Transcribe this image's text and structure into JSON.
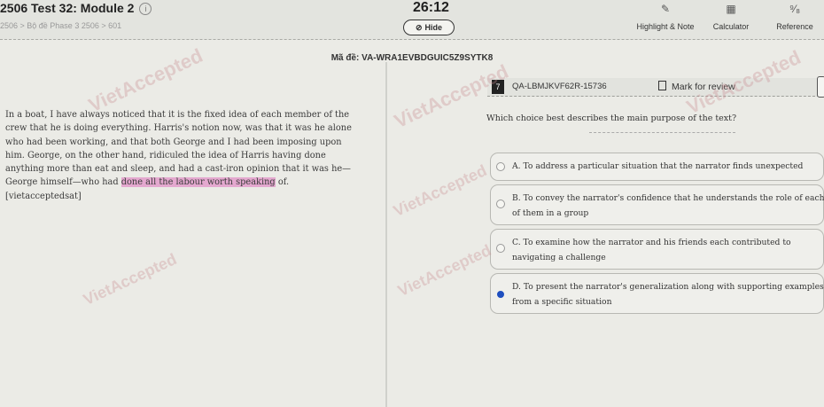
{
  "header": {
    "title": "2506 Test 32: Module 2",
    "breadcrumb": "2506 > Bộ đề Phase 3 2506 > 601",
    "timer": "26:12",
    "hide_label": "Hide",
    "tools": [
      {
        "label": "Highlight & Note",
        "icon": "pencil-icon"
      },
      {
        "label": "Calculator",
        "icon": "calculator-icon"
      },
      {
        "label": "Reference",
        "icon": "reference-icon"
      }
    ]
  },
  "exam_code": "Mã đề: VA-WRA1EVBDGUIC5Z9SYTK8",
  "passage": {
    "before_highlight": "In a boat, I have always noticed that it is the fixed idea of each member of the crew that he is doing everything. Harris's notion now, was that it was he alone who had been working, and that both George and I had been imposing upon him. George, on the other hand, ridiculed the idea of Harris having done anything more than eat and sleep, and had a cast-iron opinion that it was he—George himself—who had ",
    "highlight": "done all the labour worth speaking",
    "after_highlight": " of.",
    "source_tag": "[vietacceptedsat]"
  },
  "question": {
    "number": "7",
    "id": "QA-LBMJKVF62R-15736",
    "mark_label": "Mark for review",
    "text": "Which choice best describes the main purpose of the text?",
    "options": [
      {
        "text": "A. To address a particular situation that the narrator finds unexpected",
        "selected": false
      },
      {
        "text": "B. To convey the narrator's confidence that he understands the role of each of them in a group",
        "selected": false
      },
      {
        "text": "C. To examine how the narrator and his friends each contributed to navigating a challenge",
        "selected": false
      },
      {
        "text": "D. To present the narrator's generalization along with supporting examples from a specific situation",
        "selected": true
      }
    ]
  },
  "watermark_text": "VietAccepted",
  "colors": {
    "highlight": "#e4a8cf",
    "selected_radio": "#1f4fbf"
  }
}
